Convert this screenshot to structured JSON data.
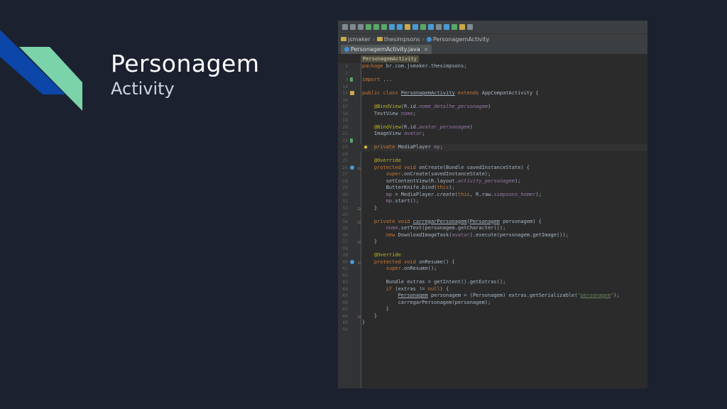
{
  "slide": {
    "title": "Personagem",
    "subtitle": "Activity"
  },
  "colors": {
    "accent_blue": "#0b46a8",
    "accent_green": "#7bd3aa",
    "background": "#1c2130",
    "ide_bg": "#2b2b2b"
  },
  "ide": {
    "nav": {
      "project": "jsmaker",
      "module": "thesimpsons",
      "class": "PersonagemActivity"
    },
    "tab": {
      "label": "PersonagemActivity.java",
      "close": "×"
    },
    "breadcrumb": "PersonagemActivity",
    "lines": [
      {
        "n": "1",
        "html": "<span class='kw'>package</span> br.com.jsmaker.thesimpsons;"
      },
      {
        "n": "2",
        "html": ""
      },
      {
        "n": "3",
        "html": "<span class='kw'>import</span> ..."
      },
      {
        "n": "14",
        "html": ""
      },
      {
        "n": "15",
        "html": "<span class='kw'>public class</span> <span class='cls'>PersonagemActivity</span> <span class='kw'>extends</span> AppCompatActivity {"
      },
      {
        "n": "16",
        "html": ""
      },
      {
        "n": "17",
        "html": "    <span class='ann'>@BindView</span>(R.id.<span class='fld ital'>nome_detalhe_personagem</span>)"
      },
      {
        "n": "18",
        "html": "    TextView <span class='fld'>nome</span>;"
      },
      {
        "n": "19",
        "html": ""
      },
      {
        "n": "20",
        "html": "    <span class='ann'>@BindView</span>(R.id.<span class='fld ital'>avatar_personagem</span>)"
      },
      {
        "n": "21",
        "html": "    ImageView <span class='fld'>avatar</span>;"
      },
      {
        "n": "22",
        "html": ""
      },
      {
        "n": "23",
        "html": "    <span class='kw'>private</span> MediaPlayer <span class='fld'>mp</span>;"
      },
      {
        "n": "24",
        "html": ""
      },
      {
        "n": "25",
        "html": "    <span class='ann'>@Override</span>"
      },
      {
        "n": "26",
        "html": "    <span class='kw'>protected void</span> onCreate(Bundle savedInstanceState) {"
      },
      {
        "n": "27",
        "html": "        <span class='kw'>super</span>.onCreate(savedInstanceState);"
      },
      {
        "n": "28",
        "html": "        setContentView(R.layout.<span class='fld ital'>activity_personagem</span>);"
      },
      {
        "n": "29",
        "html": "        ButterKnife.<span class='ital'>bind</span>(<span class='kw'>this</span>);"
      },
      {
        "n": "30",
        "html": "        <span class='fld'>mp</span> = MediaPlayer.<span class='ital'>create</span>(<span class='kw'>this</span>, R.raw.<span class='fld ital'>simpsons_homer</span>);"
      },
      {
        "n": "31",
        "html": "        <span class='fld'>mp</span>.start();"
      },
      {
        "n": "32",
        "html": "    }"
      },
      {
        "n": "33",
        "html": ""
      },
      {
        "n": "34",
        "html": "    <span class='kw'>private void</span> <span class='cls'>carregarPersonagem</span>(<span class='cls'>Personagem</span> personagem) {"
      },
      {
        "n": "35",
        "html": "        <span class='fld'>nome</span>.setText(personagem.getCharacter());"
      },
      {
        "n": "36",
        "html": "        <span class='kw'>new</span> DownloadImageTask(<span class='fld'>avatar</span>).execute(personagem.getImage());"
      },
      {
        "n": "37",
        "html": "    }"
      },
      {
        "n": "38",
        "html": ""
      },
      {
        "n": "39",
        "html": "    <span class='ann'>@Override</span>"
      },
      {
        "n": "40",
        "html": "    <span class='kw'>protected void</span> onResume() {"
      },
      {
        "n": "41",
        "html": "        <span class='kw'>super</span>.onResume();"
      },
      {
        "n": "42",
        "html": ""
      },
      {
        "n": "43",
        "html": "        Bundle extras = getIntent().getExtras();"
      },
      {
        "n": "44",
        "html": "        <span class='kw'>if</span> (extras != <span class='kw'>null</span>) {"
      },
      {
        "n": "45",
        "html": "            <span class='cls'>Personagem</span> personagem = (Personagem) extras.getSerializable(<span class='str'>\"<span class='cls'>personagem</span>\"</span>);"
      },
      {
        "n": "46",
        "html": "            carregarPersonagem(personagem);"
      },
      {
        "n": "47",
        "html": "        }"
      },
      {
        "n": "48",
        "html": "    }"
      },
      {
        "n": "49",
        "html": "}"
      },
      {
        "n": "50",
        "html": ""
      }
    ]
  }
}
